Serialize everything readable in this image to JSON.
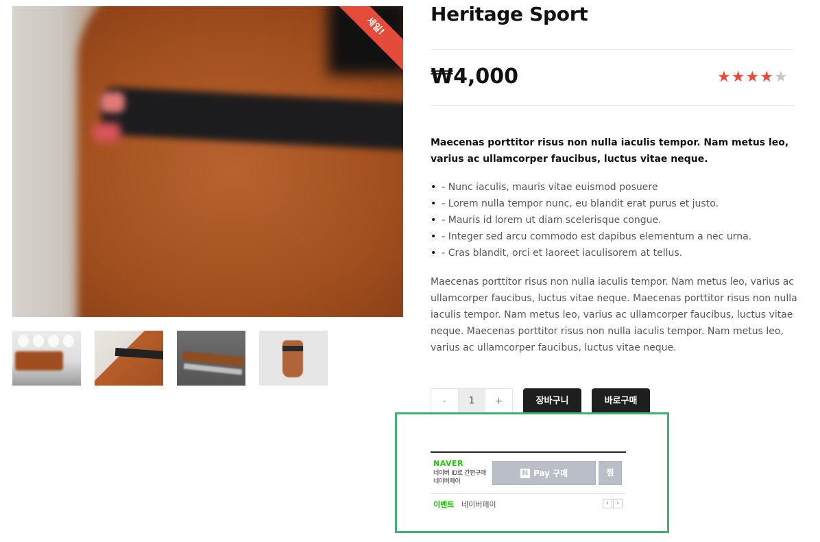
{
  "product": {
    "title": "Heritage Sport",
    "price": "₩4,000",
    "rating": 4,
    "rating_max": 5,
    "sale_badge": "세일!",
    "lead": "Maecenas porttitor risus non nulla iaculis tempor. Nam metus leo, varius ac ullamcorper faucibus, luctus vitae neque.",
    "bullets": [
      "- Nunc iaculis, mauris vitae euismod posuere",
      "- Lorem nulla tempor nunc, eu blandit erat purus et justo.",
      "- Mauris id lorem ut diam scelerisque congue.",
      "- Integer sed arcu commodo est dapibus elementum a nec urna.",
      "- Cras blandit, orci et laoreet iaculisorem at tellus."
    ],
    "description": "Maecenas porttitor risus non nulla iaculis tempor. Nam metus leo, varius ac ullamcorper faucibus, luctus vitae neque. Maecenas porttitor risus non nulla iaculis tempor. Nam metus leo, varius ac ullamcorper faucibus, luctus vitae neque. Maecenas porttitor risus non nulla iaculis tempor. Nam metus leo, varius ac ullamcorper faucibus, luctus vitae neque."
  },
  "quantity": {
    "minus": "-",
    "value": "1",
    "plus": "+"
  },
  "buttons": {
    "cart": "장바구니",
    "buy_now": "바로구매"
  },
  "naverpay": {
    "logo": "NAVER",
    "sub_line1": "네이버 ID로 간편구매",
    "sub_line2": "네이버페이",
    "n_icon": "N",
    "pay_label": "Pay 구매",
    "jjim": "찜",
    "event_label": "이벤트",
    "event_text": "네이버페이",
    "prev": "‹",
    "next": "›"
  },
  "colors": {
    "accent_red": "#e54b3b",
    "naver_green": "#1ec800",
    "highlight_frame": "#3cb371",
    "dark_button": "#1f1f1f"
  }
}
